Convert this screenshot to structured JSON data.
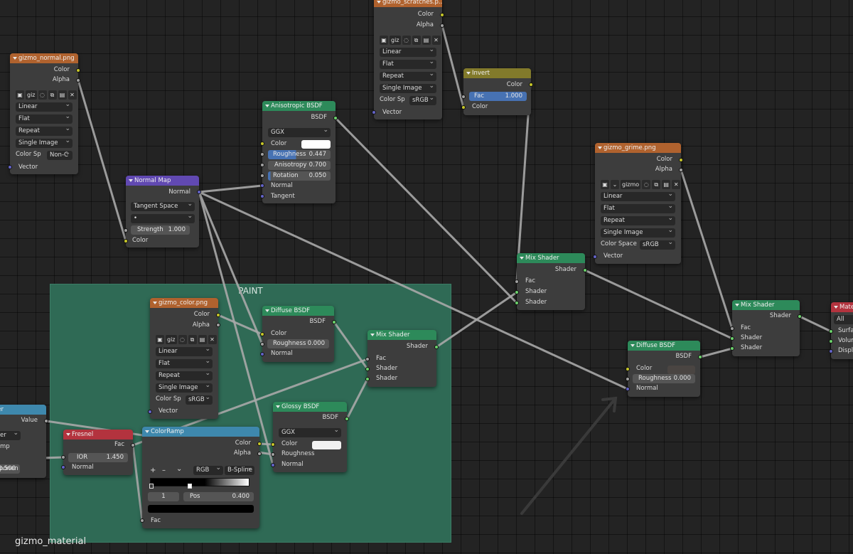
{
  "material_name": "gizmo_material",
  "frame": {
    "label": "PAINT"
  },
  "nodes": {
    "normal_tex": {
      "title": "gizmo_normal.png",
      "out1": "Color",
      "out2": "Alpha",
      "img": "giz",
      "interp": "Linear",
      "proj": "Flat",
      "ext": "Repeat",
      "src": "Single Image",
      "cs_label": "Color Sp",
      "cs_value": "Non-C",
      "vec": "Vector"
    },
    "scratch_tex": {
      "title": "gizmo_scratches.p...",
      "out1": "Color",
      "out2": "Alpha",
      "img": "giz",
      "interp": "Linear",
      "proj": "Flat",
      "ext": "Repeat",
      "src": "Single Image",
      "cs_label": "Color Sp",
      "cs_value": "sRGB",
      "vec": "Vector"
    },
    "grime_tex": {
      "title": "gizmo_grime.png",
      "out1": "Color",
      "out2": "Alpha",
      "img": "gizmo",
      "interp": "Linear",
      "proj": "Flat",
      "ext": "Repeat",
      "src": "Single Image",
      "cs_label": "Color Space",
      "cs_value": "sRGB",
      "vec": "Vector"
    },
    "color_tex": {
      "title": "gizmo_color.png",
      "out1": "Color",
      "out2": "Alpha",
      "img": "giz",
      "interp": "Linear",
      "proj": "Flat",
      "ext": "Repeat",
      "src": "Single Image",
      "cs_label": "Color Sp",
      "cs_value": "sRGB",
      "vec": "Vector"
    },
    "invert": {
      "title": "Invert",
      "out": "Color",
      "fac_label": "Fac",
      "fac_value": "1.000",
      "col": "Color"
    },
    "aniso": {
      "title": "Anisotropic BSDF",
      "out": "BSDF",
      "dist": "GGX",
      "color": "Color",
      "rough_label": "Roughness",
      "rough_value": "0.447",
      "aniso_label": "Anisotropy",
      "aniso_value": "0.700",
      "rot_label": "Rotation",
      "rot_value": "0.050",
      "normal": "Normal",
      "tangent": "Tangent"
    },
    "normal_map": {
      "title": "Normal Map",
      "out": "Normal",
      "space": "Tangent Space",
      "uv": "•",
      "str_label": "Strength",
      "str_value": "1.000",
      "col": "Color"
    },
    "diffuse1": {
      "title": "Diffuse BSDF",
      "out": "BSDF",
      "color": "Color",
      "rough_label": "Roughness",
      "rough_value": "0.000",
      "normal": "Normal"
    },
    "diffuse2": {
      "title": "Diffuse BSDF",
      "out": "BSDF",
      "color": "Color",
      "rough_label": "Roughness",
      "rough_value": "0.000",
      "normal": "Normal"
    },
    "glossy": {
      "title": "Glossy BSDF",
      "out": "BSDF",
      "dist": "GGX",
      "color": "Color",
      "rough": "Roughness",
      "normal": "Normal"
    },
    "mix_paint": {
      "title": "Mix Shader",
      "out": "Shader",
      "fac": "Fac",
      "s1": "Shader",
      "s2": "Shader"
    },
    "mix_mid": {
      "title": "Mix Shader",
      "out": "Shader",
      "fac": "Fac",
      "s1": "Shader",
      "s2": "Shader"
    },
    "mix_right": {
      "title": "Mix Shader",
      "out": "Shader",
      "fac": "Fac",
      "s1": "Shader",
      "s2": "Shader"
    },
    "fresnel": {
      "title": "Fresnel",
      "out": "Fac",
      "ior_label": "IOR",
      "ior_value": "1.450",
      "normal": "Normal"
    },
    "colorramp": {
      "title": "ColorRamp",
      "out1": "Color",
      "out2": "Alpha",
      "plus": "+",
      "minus": "–",
      "menu": "⌄",
      "mode": "RGB",
      "interp": "B-Spline",
      "index": "1",
      "pos_label": "Pos",
      "pos_value": "0.400",
      "fac": "Fac"
    },
    "layer_weight": {
      "title": "er",
      "out": "Value",
      "dd": "er",
      "mp": "mp",
      "blend_label": "ponen",
      "blend_value": "0.500"
    },
    "mat_out": {
      "title": "Mate",
      "target": "All",
      "surf": "Surfac",
      "vol": "Volum",
      "disp": "Displa"
    }
  }
}
